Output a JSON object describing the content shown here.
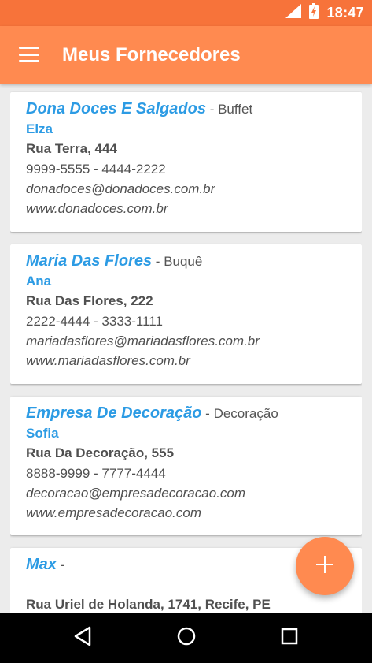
{
  "status_bar": {
    "time": "18:47"
  },
  "app_bar": {
    "title": "Meus Fornecedores",
    "menu_icon": "menu-icon"
  },
  "suppliers": [
    {
      "name": "Dona Doces E Salgados",
      "separator": " - ",
      "category": "Buffet",
      "contact": "Elza",
      "address": "Rua Terra, 444",
      "phones": "9999-5555 - 4444-2222",
      "email": "donadoces@donadoces.com.br",
      "website": "www.donadoces.com.br"
    },
    {
      "name": "Maria Das Flores",
      "separator": " - ",
      "category": "Buquê",
      "contact": "Ana",
      "address": "Rua Das Flores, 222",
      "phones": "2222-4444 - 3333-1111",
      "email": "mariadasflores@mariadasflores.com.br",
      "website": "www.mariadasflores.com.br"
    },
    {
      "name": "Empresa De Decoração",
      "separator": " - ",
      "category": "Decoração",
      "contact": "Sofia",
      "address": "Rua Da Decoração, 555",
      "phones": "8888-9999 - 7777-4444",
      "email": "decoracao@empresadecoracao.com",
      "website": "www.empresadecoracao.com"
    },
    {
      "name": "Max",
      "separator": " -",
      "category": "",
      "contact": "",
      "address": "Rua Uriel de Holanda, 1741, Recife, PE"
    }
  ],
  "fab": {
    "icon": "plus-icon"
  },
  "nav": {
    "back_icon": "back-icon",
    "home_icon": "home-icon",
    "recents_icon": "recents-icon"
  },
  "colors": {
    "status_bar": "#f7733a",
    "app_bar": "#ff8a50",
    "accent_text": "#2c9be4",
    "fab": "#ff8a50"
  }
}
